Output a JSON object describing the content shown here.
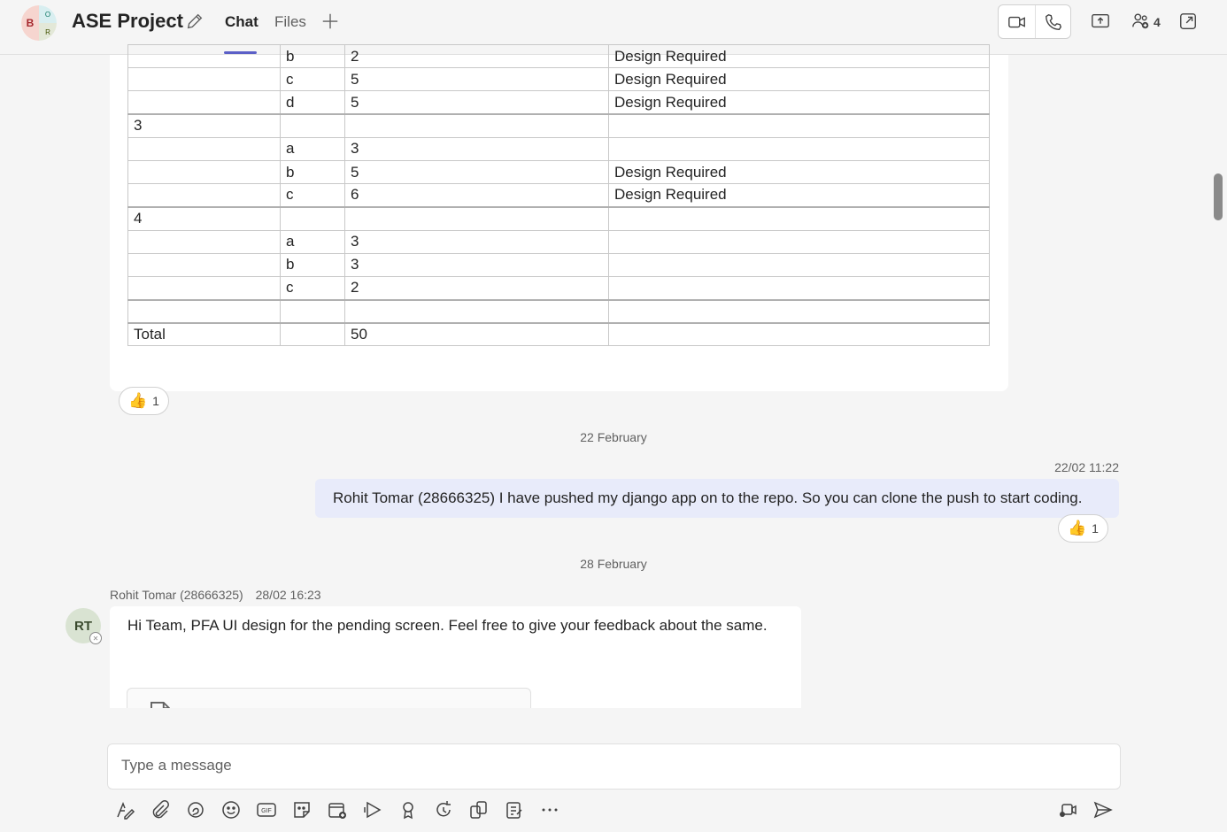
{
  "header": {
    "avatar_initials": [
      "B",
      "O",
      "R"
    ],
    "title": "ASE Project",
    "tabs": [
      {
        "label": "Chat",
        "active": true
      },
      {
        "label": "Files",
        "active": false
      }
    ],
    "participants_count": "4",
    "accent_color": "#5b5fc7"
  },
  "table": {
    "rows": [
      [
        "",
        "b",
        "2",
        "Design Required"
      ],
      [
        "",
        "c",
        "5",
        "Design Required"
      ],
      [
        "",
        "d",
        "5",
        "Design Required"
      ],
      [
        "3",
        "",
        "",
        ""
      ],
      [
        "",
        "a",
        "3",
        ""
      ],
      [
        "",
        "b",
        "5",
        "Design Required"
      ],
      [
        "",
        "c",
        "6",
        "Design Required"
      ],
      [
        "4",
        "",
        "",
        ""
      ],
      [
        "",
        "a",
        "3",
        ""
      ],
      [
        "",
        "b",
        "3",
        ""
      ],
      [
        "",
        "c",
        "2",
        ""
      ],
      [
        "",
        "",
        "",
        ""
      ],
      [
        "Total",
        "",
        "50",
        ""
      ]
    ]
  },
  "reaction1": {
    "emoji": "👍",
    "count": "1"
  },
  "date_sep1": "22 February",
  "my_message": {
    "time": "22/02 11:22",
    "text": "Rohit Tomar (28666325) I have pushed my django app on to the repo. So you can clone the push to start coding."
  },
  "reaction2": {
    "emoji": "👍",
    "count": "1"
  },
  "date_sep2": "28 February",
  "their_message": {
    "sender": "Rohit Tomar (28666325)",
    "time": "28/02 16:23",
    "initials": "RT",
    "text": "Hi Team,  PFA UI design for the pending screen. Feel free to give your feedback about the same."
  },
  "compose": {
    "placeholder": "Type a message"
  }
}
